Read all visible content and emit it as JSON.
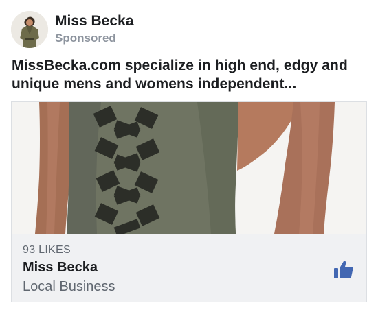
{
  "post": {
    "page_name": "Miss Becka",
    "sponsored_label": "Sponsored",
    "text": "MissBecka.com specialize in high end, edgy and unique mens and womens independent..."
  },
  "card": {
    "likes": "93 LIKES",
    "title": "Miss Becka",
    "subtitle": "Local Business",
    "like_icon": "thumbs-up-icon"
  },
  "colors": {
    "accent": "#4267b2",
    "shirt": "#6f7462",
    "skin": "#a87258"
  }
}
